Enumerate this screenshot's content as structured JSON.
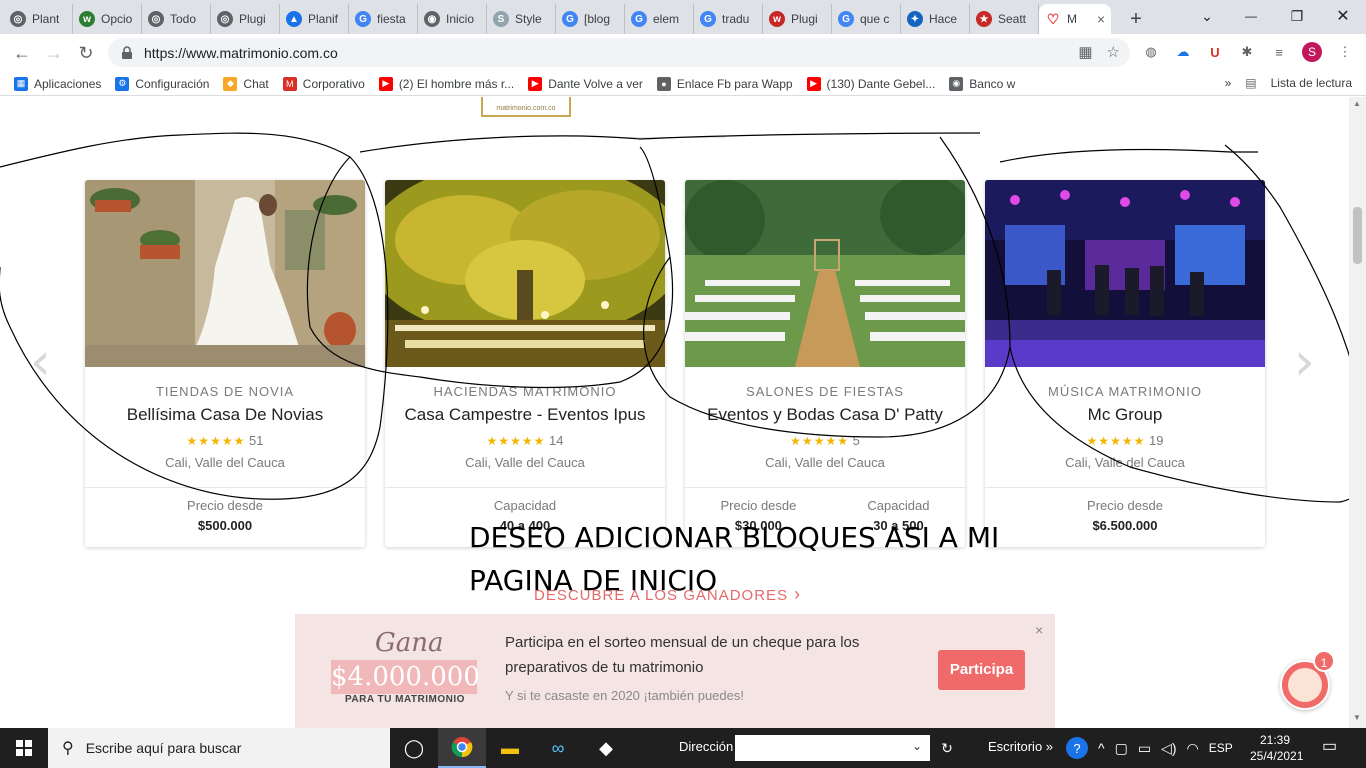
{
  "browser": {
    "tabs": [
      {
        "label": "Plant",
        "color": "#5f6368",
        "glyph": "◎"
      },
      {
        "label": "Opcio",
        "color": "#2e7d32",
        "glyph": "w"
      },
      {
        "label": "Todo",
        "color": "#5f6368",
        "glyph": "◎"
      },
      {
        "label": "Plugi",
        "color": "#5f6368",
        "glyph": "◎"
      },
      {
        "label": "Planif",
        "color": "#1a73e8",
        "glyph": "▲"
      },
      {
        "label": "fiesta",
        "color": "#4285f4",
        "glyph": "G"
      },
      {
        "label": "Inicio",
        "color": "#5f6368",
        "glyph": "◉"
      },
      {
        "label": "Style",
        "color": "#90a4ae",
        "glyph": "S"
      },
      {
        "label": "[blog",
        "color": "#4285f4",
        "glyph": "G"
      },
      {
        "label": "elem",
        "color": "#4285f4",
        "glyph": "G"
      },
      {
        "label": "tradu",
        "color": "#4285f4",
        "glyph": "G"
      },
      {
        "label": "Plugi",
        "color": "#c62828",
        "glyph": "w"
      },
      {
        "label": "que c",
        "color": "#4285f4",
        "glyph": "G"
      },
      {
        "label": "Hace",
        "color": "#1565c0",
        "glyph": "✦"
      },
      {
        "label": "Seatt",
        "color": "#c62828",
        "glyph": "★"
      }
    ],
    "active_tab": {
      "label": "M",
      "color": "#e53935",
      "glyph": "♡"
    },
    "address": "https://www.matrimonio.com.co",
    "profile_initial": "S"
  },
  "bookmarks": {
    "items": [
      {
        "label": "Aplicaciones",
        "color": "#1a73e8",
        "glyph": "▦"
      },
      {
        "label": "Configuración",
        "color": "#1a73e8",
        "glyph": "⚙"
      },
      {
        "label": "Chat",
        "color": "#f9a825",
        "glyph": "◆"
      },
      {
        "label": "Corporativo",
        "color": "#d93025",
        "glyph": "M"
      },
      {
        "label": "(2) El hombre más r...",
        "color": "#ff0000",
        "glyph": "▶"
      },
      {
        "label": "Dante Volve a ver",
        "color": "#ff0000",
        "glyph": "▶"
      },
      {
        "label": "Enlace Fb para Wapp",
        "color": "#616161",
        "glyph": "●"
      },
      {
        "label": "(130) Dante Gebel...",
        "color": "#ff0000",
        "glyph": "▶"
      },
      {
        "label": "Banco w",
        "color": "#5f6368",
        "glyph": "◉"
      }
    ],
    "more": "»",
    "reading_list": "Lista de lectura"
  },
  "page": {
    "cards": [
      {
        "category": "TIENDAS DE NOVIA",
        "name": "Bellísima Casa De Novias",
        "stars": "★★★★★",
        "reviews": "51",
        "location": "Cali, Valle del Cauca",
        "footer": [
          {
            "label": "Precio desde",
            "value": "$500.000"
          }
        ]
      },
      {
        "category": "HACIENDAS MATRIMONIO",
        "name": "Casa Campestre - Eventos Ipus",
        "stars": "★★★★★",
        "reviews": "14",
        "location": "Cali, Valle del Cauca",
        "footer": [
          {
            "label": "Capacidad",
            "value": "40 a 400"
          }
        ]
      },
      {
        "category": "SALONES DE FIESTAS",
        "name": "Eventos y Bodas Casa D' Patty",
        "stars": "★★★★★",
        "reviews": "5",
        "location": "Cali, Valle del Cauca",
        "footer": [
          {
            "label": "Precio desde",
            "value": "$30.000"
          },
          {
            "label": "Capacidad",
            "value": "30 a 500"
          }
        ]
      },
      {
        "category": "MÚSICA MATRIMONIO",
        "name": "Mc Group",
        "stars": "★★★★★",
        "reviews": "19",
        "location": "Cali, Valle del Cauca",
        "footer": [
          {
            "label": "Precio desde",
            "value": "$6.500.000"
          }
        ]
      }
    ],
    "annotation_line1": "DESEO ADICIONAR BLOQUES ASI A MI",
    "annotation_line2": "PAGINA DE INICIO",
    "discover_link": "DESCUBRE A LOS GANADORES",
    "promo": {
      "gana": "Gana",
      "amount": "$4.000.000",
      "para": "PARA TU MATRIMONIO",
      "text": "Participa en el sorteo mensual de un cheque para los preparativos de tu matrimonio",
      "subtext": "Y si te casaste en 2020 ¡también puedes!",
      "button": "Participa",
      "close": "×"
    },
    "chat_badge": "1"
  },
  "taskbar": {
    "search_placeholder": "Escribe aquí para buscar",
    "direccion_label": "Dirección",
    "escritorio_label": "Escritorio",
    "language": "ESP",
    "time": "21:39",
    "date": "25/4/2021"
  }
}
